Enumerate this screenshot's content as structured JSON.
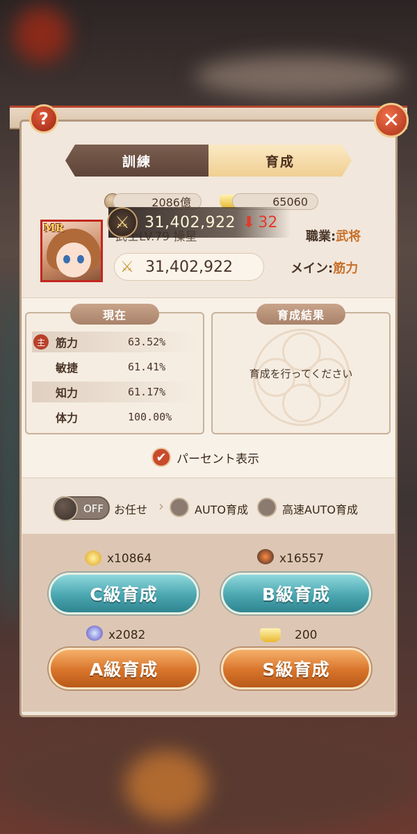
{
  "dialog": {
    "help_label": "?",
    "close_label": "✕"
  },
  "tabs": [
    {
      "label": "訓練",
      "active": false
    },
    {
      "label": "育成",
      "active": true
    }
  ],
  "character": {
    "rarity": "MR",
    "level_text": "武士LV.79  操星",
    "resources": {
      "coins": "2086億",
      "gold": "65060"
    },
    "power_change": {
      "value": "31,402,922",
      "delta": "32",
      "direction": "down"
    },
    "combat_power": "31,402,922",
    "job_label": "職業:",
    "job_value": "武将",
    "main_label": "メイン:",
    "main_value": "筋力"
  },
  "current_panel": {
    "title": "現在",
    "main_badge": "主",
    "stats": [
      {
        "label": "筋力",
        "value": "63.52%",
        "main": true
      },
      {
        "label": "敏捷",
        "value": "61.41%",
        "main": false
      },
      {
        "label": "知力",
        "value": "61.17%",
        "main": false
      },
      {
        "label": "体力",
        "value": "100.00%",
        "main": false
      }
    ]
  },
  "result_panel": {
    "title": "育成結果",
    "message": "育成を行ってください"
  },
  "percent_toggle": {
    "label": "パーセント表示",
    "checked": true
  },
  "auto": {
    "toggle_state": "OFF",
    "delegate_label": "お任せ",
    "auto_label": "AUTO育成",
    "fast_auto_label": "高速AUTO育成"
  },
  "actions": [
    {
      "label": "C級育成",
      "cost": "x10864",
      "icon": "yellow-orb-icon",
      "style": "teal"
    },
    {
      "label": "B級育成",
      "cost": "x16557",
      "icon": "fire-pot-icon",
      "style": "teal"
    },
    {
      "label": "A級育成",
      "cost": "x2082",
      "icon": "blue-orb-icon",
      "style": "orange"
    },
    {
      "label": "S級育成",
      "cost": "200",
      "icon": "gold-ingot-icon",
      "style": "orange"
    }
  ],
  "colors": {
    "accent": "#c8702a",
    "danger": "#e23a2a",
    "teal": "#4aa6b0",
    "orange": "#d8742a"
  }
}
